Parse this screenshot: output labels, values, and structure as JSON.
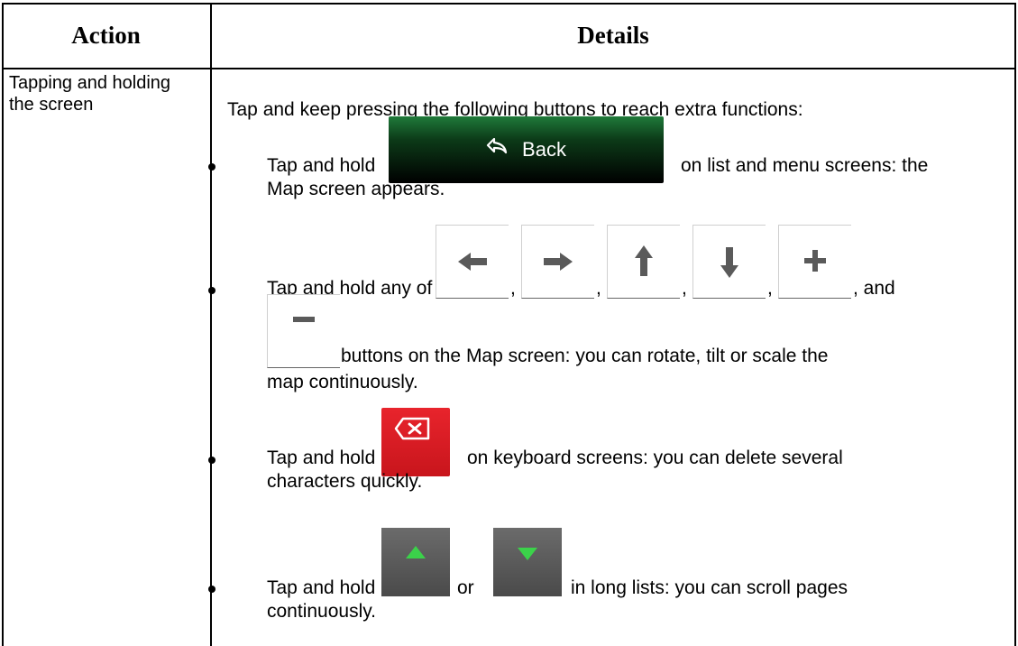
{
  "header": {
    "action": "Action",
    "details": "Details"
  },
  "row": {
    "action_label": "Tapping and holding the screen",
    "intro": "Tap and keep pressing the following buttons to reach extra functions:",
    "bullets": {
      "b1": {
        "line1_pre": "Tap and hold",
        "line1_post": "on list and menu screens: the",
        "line2": "Map screen appears."
      },
      "b2": {
        "line1_pre": "Tap and hold any of the",
        "sep1": ",",
        "sep2": ",",
        "sep3": ",",
        "sep4": ",",
        "line1_post": ", and",
        "line2": "buttons on the Map screen: you can rotate, tilt or scale the",
        "line3": "map continuously."
      },
      "b3": {
        "line1_pre": "Tap and hold",
        "line1_post": "on keyboard screens: you can delete several",
        "line2": "characters quickly."
      },
      "b4": {
        "line1_pre": "Tap and hold",
        "mid": "or",
        "line1_post": "in long lists: you can scroll pages",
        "line2": "continuously."
      }
    }
  },
  "buttons": {
    "back_label": "Back",
    "back_icon": "back-arrow-icon",
    "map_icons": [
      "left-arrow-icon",
      "right-arrow-icon",
      "up-arrow-icon",
      "down-arrow-icon",
      "plus-icon",
      "minus-icon"
    ],
    "delete_icon": "backspace-icon",
    "scroll_icons": [
      "scroll-up-icon",
      "scroll-down-icon"
    ],
    "colors": {
      "back_top": "#1f7a3a",
      "delete": "#e0202a",
      "scroll_green": "#3bd24a",
      "gray_btn": "#555555"
    }
  }
}
